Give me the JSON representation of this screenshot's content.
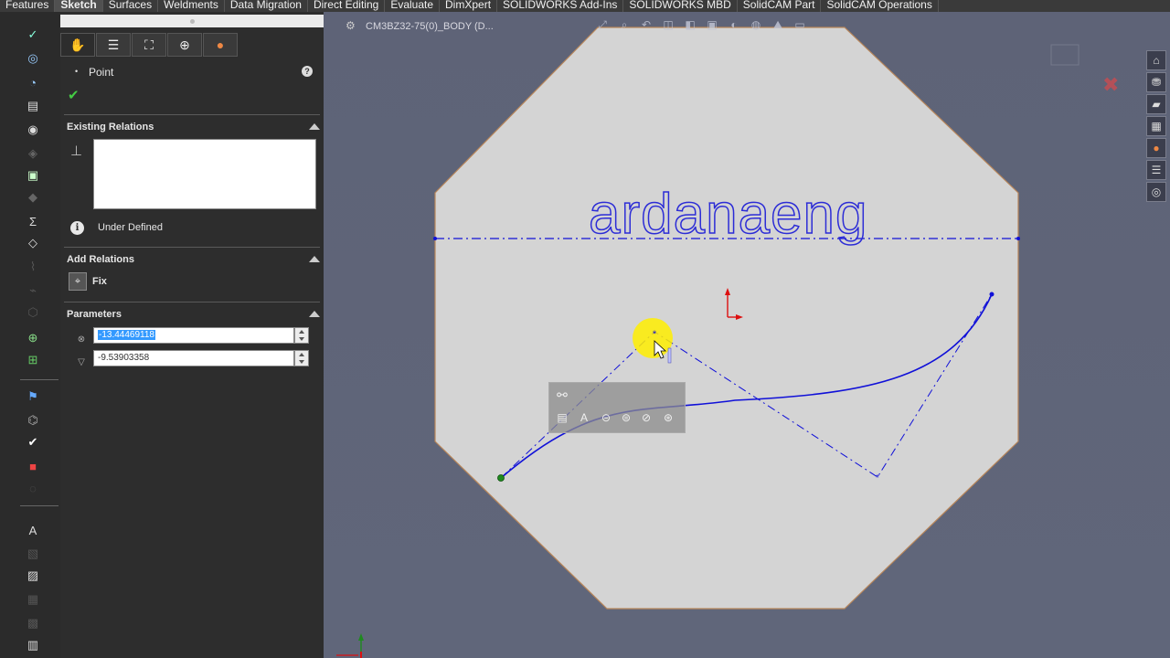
{
  "tabs": [
    "Features",
    "Sketch",
    "Surfaces",
    "Weldments",
    "Data Migration",
    "Direct Editing",
    "Evaluate",
    "DimXpert",
    "SOLIDWORKS Add-Ins",
    "SOLIDWORKS MBD",
    "SolidCAM Part",
    "SolidCAM Operations"
  ],
  "active_tab": "Sketch",
  "property_manager": {
    "title": "Point",
    "existing_relations_label": "Existing Relations",
    "status": "Under Defined",
    "add_relations_label": "Add Relations",
    "fix_label": "Fix",
    "parameters_label": "Parameters",
    "x_value": "-13.44469118",
    "y_value": "-9.53903358"
  },
  "graphics": {
    "breadcrumb": "CM3BZ32-75(0)_BODY  (D...",
    "watermark_text": "ardanaeng"
  },
  "colors": {
    "sketch_blue": "#1010d8",
    "body_fill": "#d4d4d4",
    "body_edge": "#b8865a",
    "origin_red": "#dd1010",
    "highlight_yellow": "#ffee00",
    "endpoint_green": "#1f8a1f"
  }
}
